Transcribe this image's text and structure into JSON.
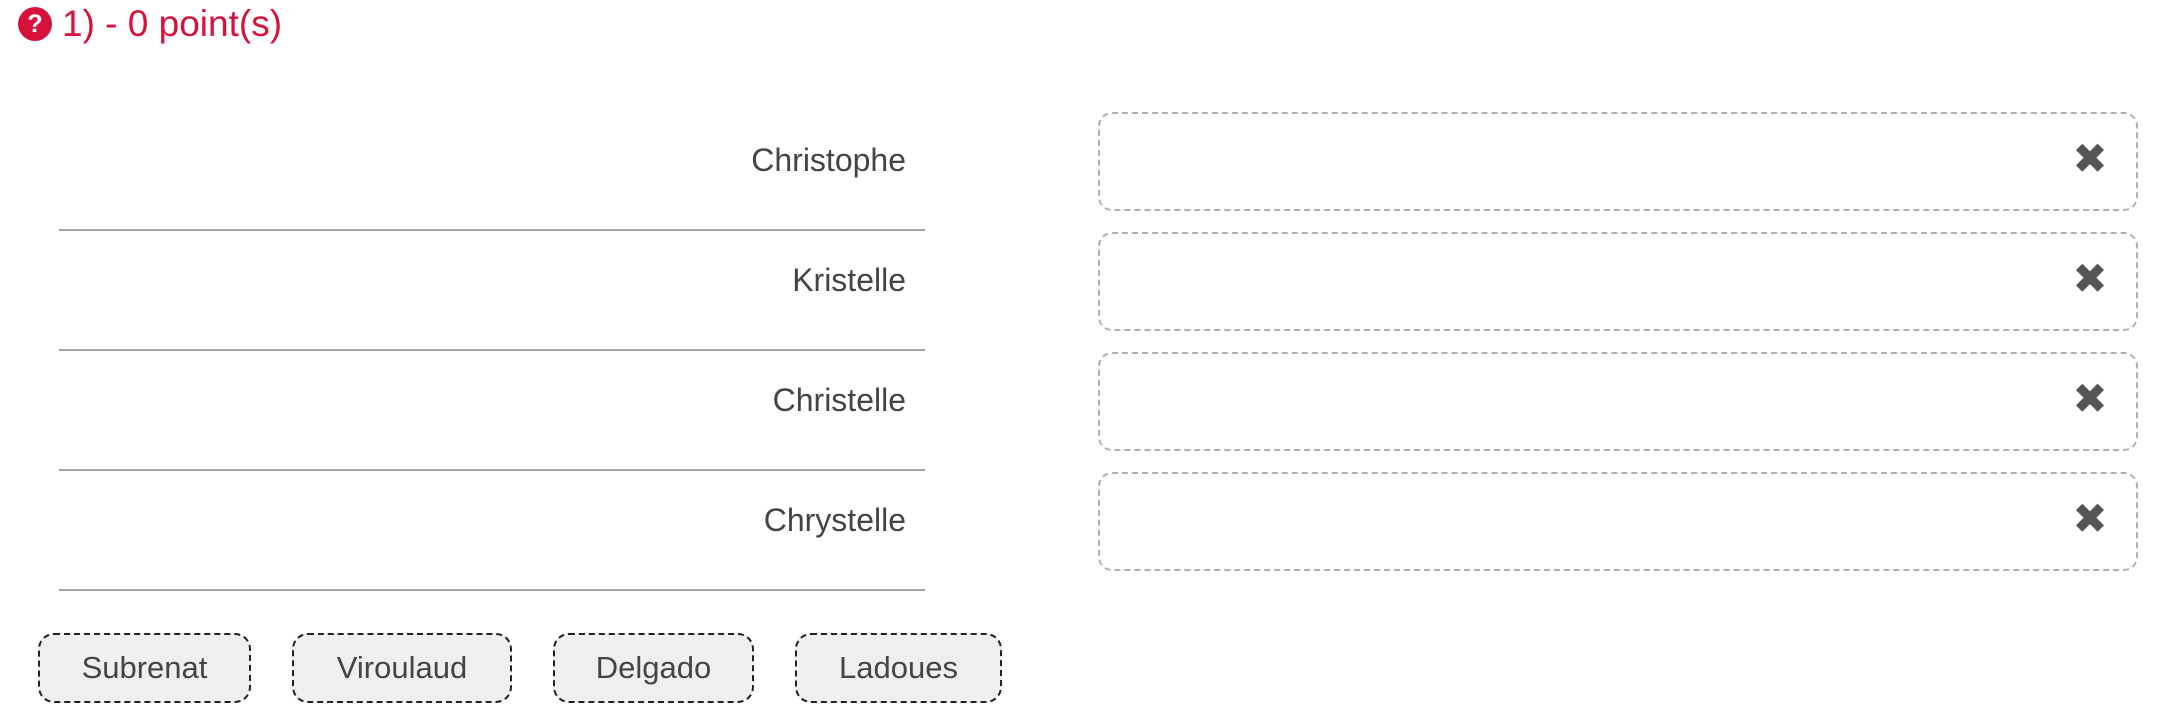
{
  "question": {
    "icon": "question-circle-icon",
    "title": "1) - 0 point(s)",
    "accent_color": "#d6123c"
  },
  "rows": [
    {
      "label": "Christophe",
      "answer": ""
    },
    {
      "label": "Kristelle",
      "answer": ""
    },
    {
      "label": "Christelle",
      "answer": ""
    },
    {
      "label": "Chrystelle",
      "answer": ""
    }
  ],
  "clear_icon": "close-icon",
  "tokens": [
    {
      "label": "Subrenat"
    },
    {
      "label": "Viroulaud"
    },
    {
      "label": "Delgado"
    },
    {
      "label": "Ladoues"
    }
  ]
}
